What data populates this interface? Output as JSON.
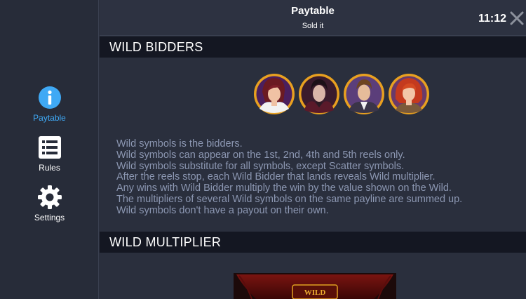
{
  "sidebar": {
    "items": [
      {
        "label": "Paytable",
        "icon": "info-icon",
        "active": true
      },
      {
        "label": "Rules",
        "icon": "list-icon",
        "active": false
      },
      {
        "label": "Settings",
        "icon": "gear-icon",
        "active": false
      }
    ]
  },
  "header": {
    "title": "Paytable",
    "subtitle": "Sold it",
    "clock": "11:12",
    "close_icon": "close-icon"
  },
  "sections": {
    "wild_bidders": {
      "title": "WILD BIDDERS",
      "symbols": [
        "bidder-woman-fur-icon",
        "bidder-man-vampire-icon",
        "bidder-man-suit-icon",
        "bidder-woman-red-hair-icon"
      ],
      "lines": [
        "Wild symbols is the bidders.",
        "Wild symbols can appear on the 1st, 2nd, 4th and 5th reels only.",
        "Wild symbols substitute for all symbols, except Scatter symbols.",
        "After the reels stop, each Wild Bidder that lands reveals Wild multiplier.",
        "Any wins with Wild Bidder multiply the win by the value shown on the Wild.",
        "The multipliers of several Wild symbols on the same payline are summed up.",
        "Wild symbols don't have a payout on their own."
      ]
    },
    "wild_multiplier": {
      "title": "WILD MULTIPLIER",
      "panel_label": "WILD"
    }
  },
  "colors": {
    "accent": "#3fa9f5",
    "background": "#2a2f3d",
    "sidebar": "#272c39",
    "section_bar": "#141722",
    "body_text": "#8c97b2",
    "gold": "#e0a020"
  }
}
